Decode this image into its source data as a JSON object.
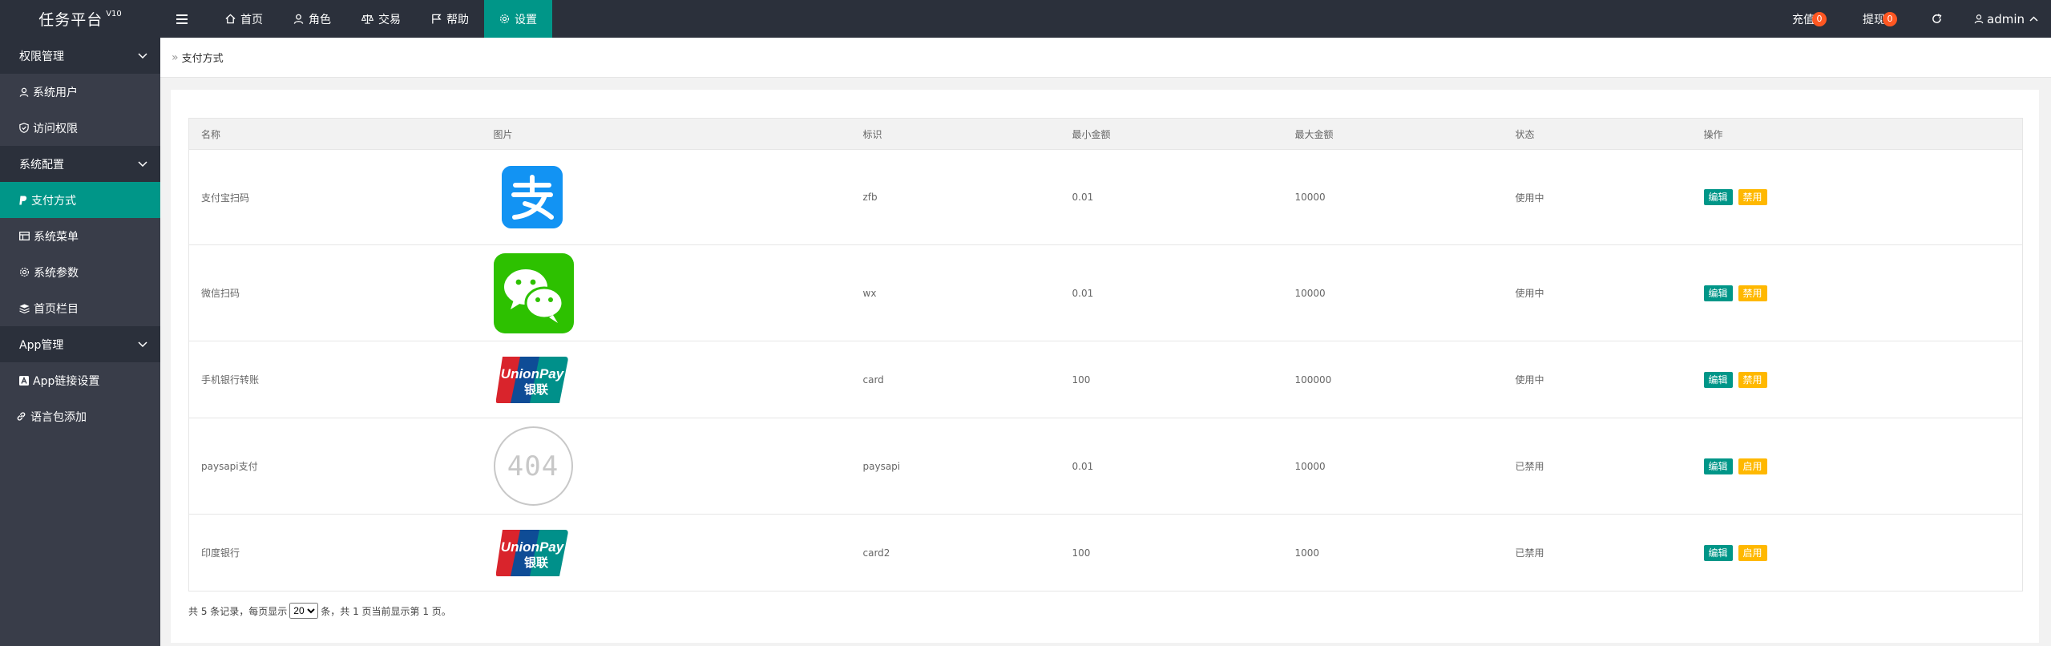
{
  "app": {
    "title": "任务平台",
    "version": "V10"
  },
  "topnav": {
    "menu_toggle": "",
    "items": [
      {
        "label": "首页",
        "icon": "home-icon"
      },
      {
        "label": "角色",
        "icon": "user-icon"
      },
      {
        "label": "交易",
        "icon": "scale-icon"
      },
      {
        "label": "帮助",
        "icon": "flag-icon"
      },
      {
        "label": "设置",
        "icon": "gear-icon",
        "active": true
      }
    ],
    "recharge": {
      "label": "充值",
      "count": "0"
    },
    "withdraw": {
      "label": "提现",
      "count": "0"
    },
    "user": "admin"
  },
  "sidebar": {
    "groups": [
      {
        "label": "权限管理",
        "items": [
          {
            "label": "系统用户",
            "icon": "user-icon"
          },
          {
            "label": "访问权限",
            "icon": "shield-icon"
          }
        ]
      },
      {
        "label": "系统配置",
        "items": [
          {
            "label": "支付方式",
            "icon": "paypal-icon",
            "active": true
          },
          {
            "label": "系统菜单",
            "icon": "table-icon"
          },
          {
            "label": "系统参数",
            "icon": "gear-icon"
          },
          {
            "label": "首页栏目",
            "icon": "layers-icon"
          }
        ]
      },
      {
        "label": "App管理",
        "items": [
          {
            "label": "App链接设置",
            "icon": "app-icon"
          }
        ]
      }
    ],
    "extra": {
      "label": "语言包添加",
      "icon": "link-icon"
    }
  },
  "breadcrumb": "支付方式",
  "table": {
    "headers": [
      "名称",
      "图片",
      "标识",
      "最小金额",
      "最大金额",
      "状态",
      "操作"
    ],
    "rows": [
      {
        "name": "支付宝扫码",
        "image": "alipay-logo",
        "code": "zfb",
        "min": "0.01",
        "max": "10000",
        "status": "使用中",
        "enabled": true,
        "edit": "编辑",
        "toggle": "禁用"
      },
      {
        "name": "微信扫码",
        "image": "wechat-logo",
        "code": "wx",
        "min": "0.01",
        "max": "10000",
        "status": "使用中",
        "enabled": true,
        "edit": "编辑",
        "toggle": "禁用"
      },
      {
        "name": "手机银行转账",
        "image": "unionpay-logo",
        "code": "card",
        "min": "100",
        "max": "100000",
        "status": "使用中",
        "enabled": true,
        "edit": "编辑",
        "toggle": "禁用"
      },
      {
        "name": "paysapi支付",
        "image": "missing-image-404",
        "image_text": "404",
        "code": "paysapi",
        "min": "0.01",
        "max": "10000",
        "status": "已禁用",
        "enabled": false,
        "edit": "编辑",
        "toggle": "启用"
      },
      {
        "name": "印度银行",
        "image": "unionpay-logo",
        "code": "card2",
        "min": "100",
        "max": "1000",
        "status": "已禁用",
        "enabled": false,
        "edit": "编辑",
        "toggle": "启用"
      }
    ]
  },
  "pagination": {
    "prefix": "共 5 条记录，每页显示",
    "page_size": "20",
    "suffix": "条，共 1 页当前显示第 1 页。"
  },
  "colors": {
    "topbar": "#2b303b",
    "sidebar": "#393d49",
    "accent": "#009688",
    "badge": "#ff5722",
    "warn": "#ffb800",
    "status_on": "#009f2e",
    "status_off": "#ff0000"
  }
}
